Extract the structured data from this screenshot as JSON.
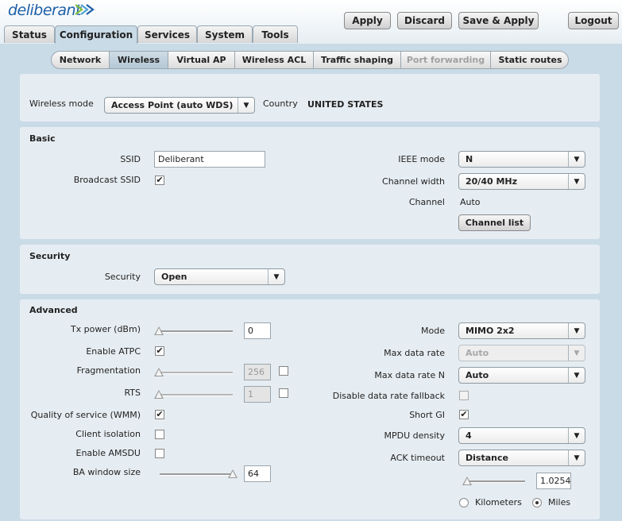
{
  "brand": {
    "logo_text": "deliberant"
  },
  "header_buttons": {
    "apply": "Apply",
    "discard": "Discard",
    "save_apply": "Save & Apply",
    "logout": "Logout"
  },
  "main_tabs": [
    "Status",
    "Configuration",
    "Services",
    "System",
    "Tools"
  ],
  "main_active": "Configuration",
  "sub_tabs": [
    "Network",
    "Wireless",
    "Virtual AP",
    "Wireless ACL",
    "Traffic shaping",
    "Port forwarding",
    "Static routes"
  ],
  "sub_active": "Wireless",
  "sub_disabled": "Port forwarding",
  "mode_panel": {
    "wireless_mode_label": "Wireless mode",
    "wireless_mode_value": "Access Point (auto WDS)",
    "country_label": "Country",
    "country_value": "UNITED STATES"
  },
  "basic": {
    "title": "Basic",
    "ssid_label": "SSID",
    "ssid_value": "Deliberant",
    "broadcast_label": "Broadcast SSID",
    "broadcast_checked": true,
    "ieee_label": "IEEE mode",
    "ieee_value": "N",
    "channel_width_label": "Channel width",
    "channel_width_value": "20/40 MHz",
    "channel_label": "Channel",
    "channel_value": "Auto",
    "channel_list_button": "Channel list"
  },
  "security": {
    "title": "Security",
    "security_label": "Security",
    "security_value": "Open"
  },
  "advanced": {
    "title": "Advanced",
    "tx_power_label": "Tx power (dBm)",
    "tx_power_value": "0",
    "atpc_label": "Enable ATPC",
    "atpc_checked": true,
    "fragmentation_label": "Fragmentation",
    "fragmentation_value": "256",
    "rts_label": "RTS",
    "rts_value": "1",
    "qos_label": "Quality of service (WMM)",
    "qos_checked": true,
    "client_isolation_label": "Client isolation",
    "client_isolation_checked": false,
    "amsdu_label": "Enable AMSDU",
    "amsdu_checked": false,
    "ba_window_label": "BA window size",
    "ba_window_value": "64",
    "mode_label": "Mode",
    "mode_value": "MIMO 2x2",
    "max_rate_label": "Max data rate",
    "max_rate_value": "Auto",
    "max_rate_n_label": "Max data rate N",
    "max_rate_n_value": "Auto",
    "disable_fallback_label": "Disable data rate fallback",
    "short_gi_label": "Short GI",
    "short_gi_checked": true,
    "mpdu_label": "MPDU density",
    "mpdu_value": "4",
    "ack_label": "ACK timeout",
    "ack_value": "Distance",
    "ack_distance_value": "1.0254",
    "km_label": "Kilometers",
    "miles_label": "Miles",
    "unit_selected": "Miles"
  },
  "colors": {
    "accent": "#1c5fa8",
    "panel_bg": "#e6edf2",
    "page_bg": "#c9dbe7"
  }
}
